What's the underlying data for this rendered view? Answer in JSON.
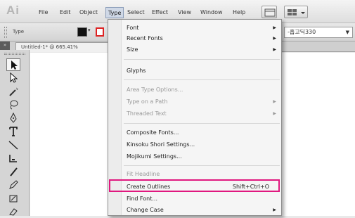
{
  "menubar": {
    "app_logo": "Ai",
    "items": [
      "File",
      "Edit",
      "Object",
      "Type",
      "Select",
      "Effect",
      "View",
      "Window",
      "Help"
    ],
    "active": "Type"
  },
  "control_bar": {
    "label": "Type",
    "font_family_value": "-홉고딕330",
    "fill_color": "#111111",
    "stroke_color": "#dd2222"
  },
  "document": {
    "tab_title": "Untitled-1* @ 665.41%",
    "collapse_glyph": "»"
  },
  "tools": {
    "icons": [
      "selection-tool-icon",
      "direct-selection-tool-icon",
      "magic-wand-tool-icon",
      "lasso-tool-icon",
      "pen-tool-icon",
      "type-tool-icon",
      "line-tool-icon",
      "rectangle-tool-icon",
      "paintbrush-tool-icon",
      "pencil-tool-icon",
      "blob-brush-tool-icon",
      "eraser-tool-icon"
    ]
  },
  "type_menu": {
    "items": [
      {
        "label": "Font",
        "shortcut": "",
        "submenu": true,
        "disabled": false
      },
      {
        "label": "Recent Fonts",
        "shortcut": "",
        "submenu": true,
        "disabled": false
      },
      {
        "label": "Size",
        "shortcut": "",
        "submenu": true,
        "disabled": false
      },
      {
        "label": "Glyphs",
        "shortcut": "",
        "submenu": false,
        "disabled": false
      },
      {
        "label": "Area Type Options...",
        "shortcut": "",
        "submenu": false,
        "disabled": true
      },
      {
        "label": "Type on a Path",
        "shortcut": "",
        "submenu": true,
        "disabled": true
      },
      {
        "label": "Threaded Text",
        "shortcut": "",
        "submenu": true,
        "disabled": true
      },
      {
        "label": "Composite Fonts...",
        "shortcut": "",
        "submenu": false,
        "disabled": false
      },
      {
        "label": "Kinsoku Shori Settings...",
        "shortcut": "",
        "submenu": false,
        "disabled": false
      },
      {
        "label": "Mojikumi Settings...",
        "shortcut": "",
        "submenu": false,
        "disabled": false
      },
      {
        "label": "Fit Headline",
        "shortcut": "",
        "submenu": false,
        "disabled": true
      },
      {
        "label": "Create Outlines",
        "shortcut": "Shift+Ctrl+O",
        "submenu": false,
        "disabled": false,
        "highlighted": true
      },
      {
        "label": "Find Font...",
        "shortcut": "",
        "submenu": false,
        "disabled": false
      },
      {
        "label": "Change Case",
        "shortcut": "",
        "submenu": true,
        "disabled": false
      }
    ],
    "highlight_color": "#e0187f"
  }
}
